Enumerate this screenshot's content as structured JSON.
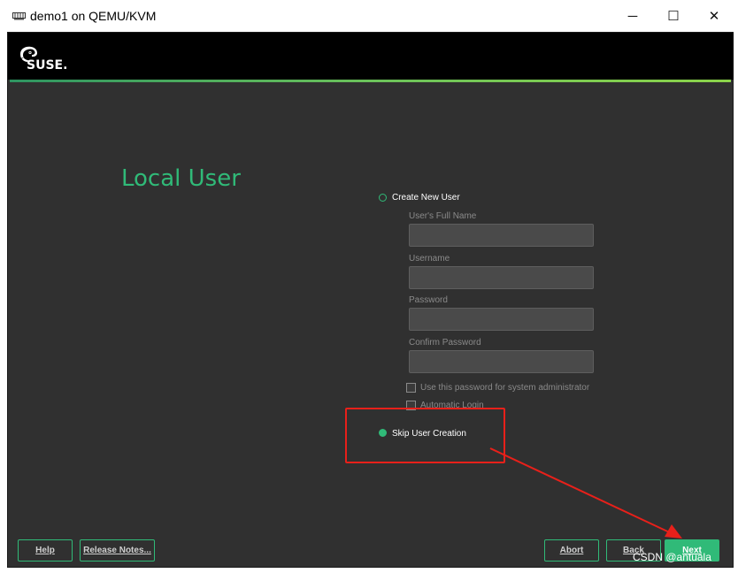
{
  "window": {
    "title": "demo1 on QEMU/KVM",
    "app_icon": "qemu-monitor-icon",
    "controls": {
      "minimize": "─",
      "maximize": "☐",
      "close": "✕"
    }
  },
  "header": {
    "logo": "suse-logo",
    "logo_text": "SUSE.",
    "accent_color": "#30ba78"
  },
  "page": {
    "title": "Local User"
  },
  "form": {
    "create_new_user": {
      "label": "Create New User",
      "selected": false
    },
    "full_name": {
      "label": "User's Full Name",
      "value": ""
    },
    "username": {
      "label": "Username",
      "value": ""
    },
    "password": {
      "label": "Password",
      "value": ""
    },
    "confirm_password": {
      "label": "Confirm Password",
      "value": ""
    },
    "use_for_admin": {
      "label": "Use this password for system administrator",
      "checked": false
    },
    "auto_login": {
      "label": "Automatic Login",
      "checked": false
    },
    "skip_user_creation": {
      "label": "Skip User Creation",
      "selected": true
    }
  },
  "buttons": {
    "help": "Help",
    "release_notes": "Release Notes...",
    "abort": "Abort",
    "back": "Back",
    "next": "Next"
  },
  "annotation": {
    "color": "#e8201a"
  },
  "watermark": "CSDN @antuala"
}
